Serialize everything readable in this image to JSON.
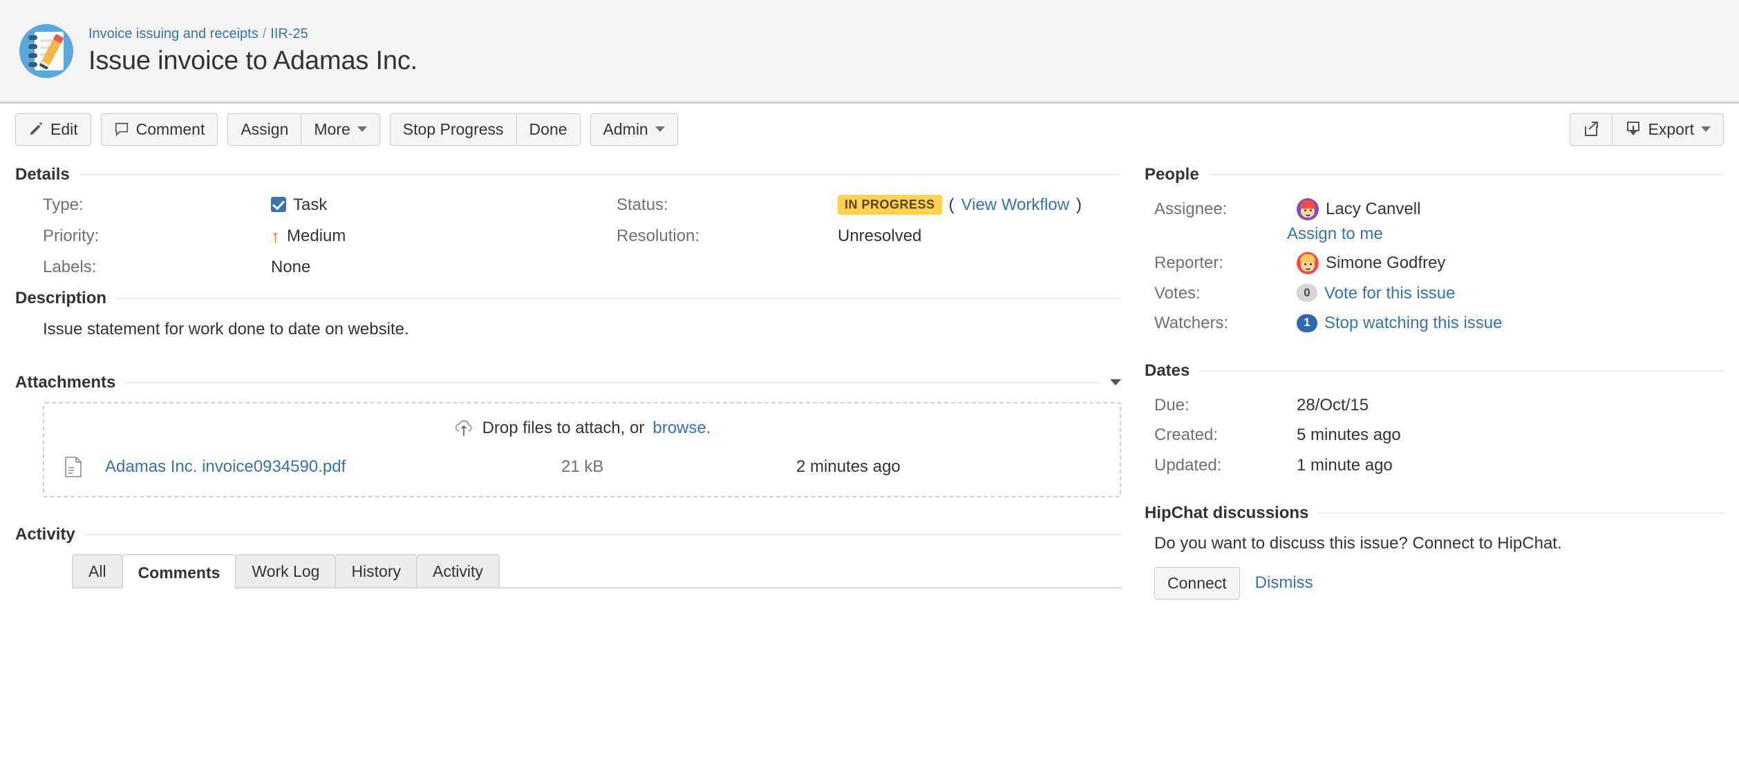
{
  "header": {
    "avatar_icon": "notepad-pencil-icon",
    "breadcrumb": {
      "project": "Invoice issuing and receipts",
      "separator": "/",
      "issue_key": "IIR-25"
    },
    "title": "Issue invoice to Adamas Inc."
  },
  "toolbar": {
    "edit_label": "Edit",
    "edit_icon": "pencil-icon",
    "comment_label": "Comment",
    "comment_icon": "speech-bubble-icon",
    "assign_label": "Assign",
    "more_label": "More",
    "stop_progress_label": "Stop Progress",
    "done_label": "Done",
    "admin_label": "Admin",
    "share_icon": "share-icon",
    "export_label": "Export",
    "export_icon": "download-icon"
  },
  "details": {
    "heading": "Details",
    "type_label": "Type:",
    "type_value": "Task",
    "type_icon": "task-checkbox-icon",
    "priority_label": "Priority:",
    "priority_value": "Medium",
    "priority_icon": "arrow-up-icon",
    "labels_label": "Labels:",
    "labels_value": "None",
    "status_label": "Status:",
    "status_value": "IN PROGRESS",
    "status_color": "#ffd351",
    "status_text_color": "#594300",
    "view_workflow_label": "View Workflow",
    "paren_open": "(",
    "paren_close": ")",
    "resolution_label": "Resolution:",
    "resolution_value": "Unresolved"
  },
  "description": {
    "heading": "Description",
    "body": "Issue statement for work done to date on website."
  },
  "attachments": {
    "heading": "Attachments",
    "toggle_icon": "chevron-down-icon",
    "dropzone_icon": "upload-cloud-icon",
    "dropzone_text": "Drop files to attach, or",
    "browse_label": "browse.",
    "file_icon": "file-document-icon",
    "file_name": "Adamas Inc. invoice0934590.pdf",
    "file_size": "21 kB",
    "file_date": "2 minutes ago"
  },
  "activity": {
    "heading": "Activity",
    "tabs": [
      {
        "label": "All",
        "active": false
      },
      {
        "label": "Comments",
        "active": true
      },
      {
        "label": "Work Log",
        "active": false
      },
      {
        "label": "History",
        "active": false
      },
      {
        "label": "Activity",
        "active": false
      }
    ]
  },
  "people": {
    "heading": "People",
    "assignee_label": "Assignee:",
    "assignee_name": "Lacy Canvell",
    "assignee_avatar_color": "#7d4dc4",
    "assignee_hair_color": "#f4503c",
    "assign_to_me_label": "Assign to me",
    "reporter_label": "Reporter:",
    "reporter_name": "Simone Godfrey",
    "reporter_avatar_color": "#f04a47",
    "reporter_hair_color": "#f6c95a",
    "votes_label": "Votes:",
    "votes_count": "0",
    "vote_link_label": "Vote for this issue",
    "watchers_label": "Watchers:",
    "watchers_count": "1",
    "watch_link_label": "Stop watching this issue"
  },
  "dates": {
    "heading": "Dates",
    "due_label": "Due:",
    "due_value": "28/Oct/15",
    "created_label": "Created:",
    "created_value": "5 minutes ago",
    "updated_label": "Updated:",
    "updated_value": "1 minute ago"
  },
  "hipchat": {
    "heading": "HipChat discussions",
    "prompt": "Do you want to discuss this issue? Connect to HipChat.",
    "connect_label": "Connect",
    "dismiss_label": "Dismiss"
  }
}
